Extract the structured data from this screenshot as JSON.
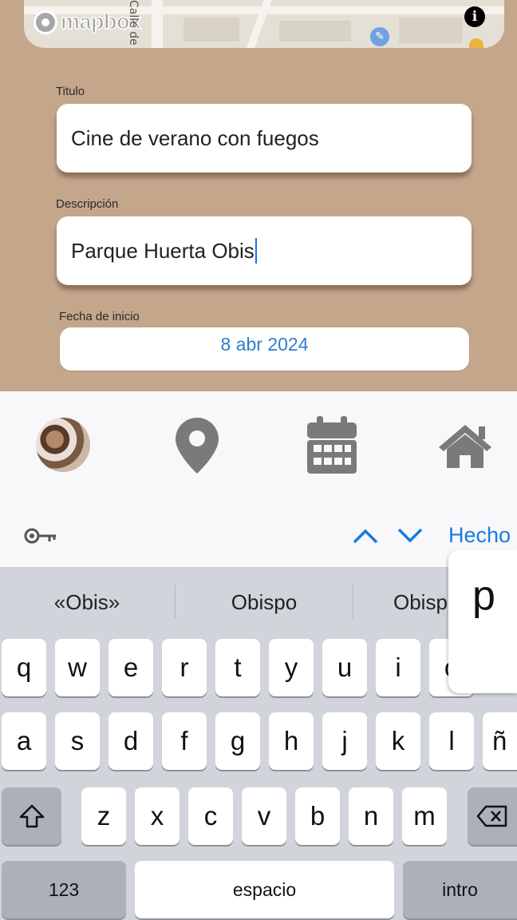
{
  "map": {
    "attribution_logo": "mapbox",
    "street_label": "Calle de",
    "info_icon": "info-icon",
    "wrench_icon": "wrench-icon"
  },
  "form": {
    "title_label": "Titulo",
    "title_value": "Cine de verano con fuegos",
    "description_label": "Descripción",
    "description_value": "Parque Huerta Obis",
    "start_date_label": "Fecha de inicio",
    "start_date_value": "8 abr 2024"
  },
  "nav": {
    "items": [
      {
        "icon": "avatar"
      },
      {
        "icon": "map-pin-icon"
      },
      {
        "icon": "calendar-icon"
      },
      {
        "icon": "home-icon"
      }
    ],
    "icon_color": "#7a7a7a"
  },
  "accessory": {
    "key_icon": "key-icon",
    "prev_icon": "chevron-up-icon",
    "next_icon": "chevron-down-icon",
    "done_label": "Hecho",
    "accent": "#1a7ae0"
  },
  "keyboard": {
    "suggestions": [
      "«Obis»",
      "Obispo",
      "Obisp"
    ],
    "row1": [
      "q",
      "w",
      "e",
      "r",
      "t",
      "y",
      "u",
      "i",
      "o"
    ],
    "row2": [
      "a",
      "s",
      "d",
      "f",
      "g",
      "h",
      "j",
      "k",
      "l",
      "ñ"
    ],
    "row3": [
      "z",
      "x",
      "c",
      "v",
      "b",
      "n",
      "m"
    ],
    "popup_key": "p",
    "numbers_label": "123",
    "space_label": "espacio",
    "return_label": "intro"
  }
}
